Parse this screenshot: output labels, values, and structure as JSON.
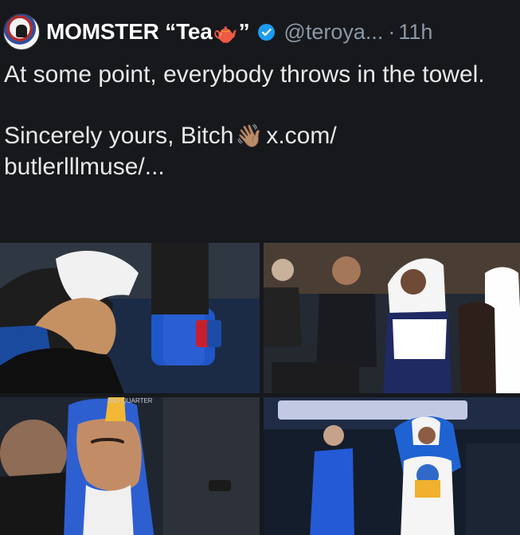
{
  "tweet": {
    "display_name_prefix": "MOMSTER “Tea",
    "display_name_suffix": "”",
    "display_name_icon": "teapot-icon",
    "verified_icon": "verified-icon",
    "handle": "@teroya...",
    "separator": "·",
    "time": "11h",
    "lines": [
      "At some point, everybody throws in the towel.",
      "Sincerely yours, Bitch",
      "x.com/",
      "butlerlllmuse/..."
    ],
    "wave_icon": "waving-hand-icon",
    "colors": {
      "background": "#16181c",
      "text": "#e7e9ea",
      "muted": "#8b98a5",
      "verified": "#1d9bf0"
    }
  },
  "media": {
    "images": [
      {
        "name": "steph-towel-over-head-on-bench",
        "icon": "photo-icon"
      },
      {
        "name": "warriors-bench-staff-and-players",
        "icon": "photo-icon"
      },
      {
        "name": "steph-closeup-with-towel",
        "icon": "photo-icon"
      },
      {
        "name": "steph-standing-in-towel-and-coach",
        "icon": "photo-icon"
      }
    ],
    "captions": [
      "2ND QUARTER"
    ]
  }
}
